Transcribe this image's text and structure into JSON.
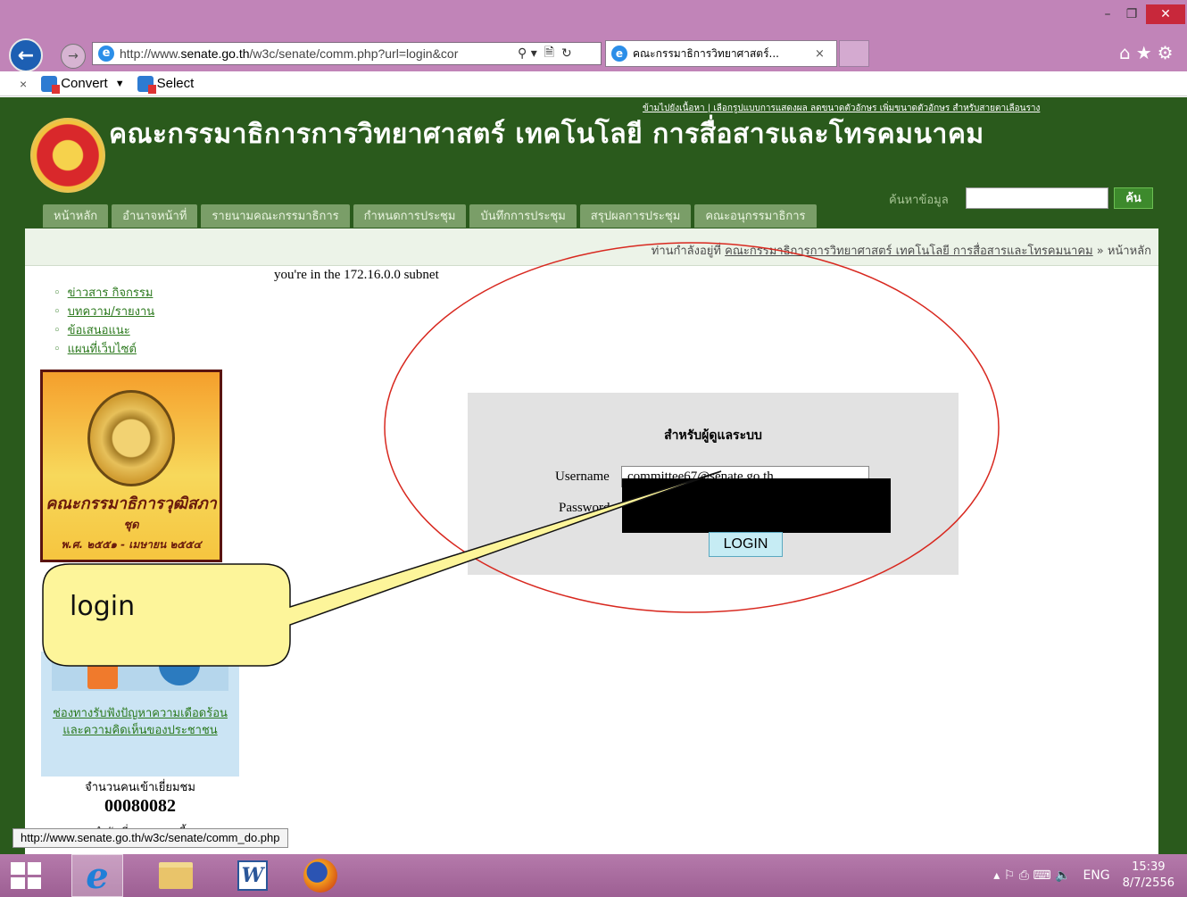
{
  "browser": {
    "url_host_prefix": "http://www.",
    "url_host": "senate.go.th",
    "url_path": "/w3c/senate/comm.php?url=login&cor",
    "tab_title": "คณะกรรมาธิการวิทยาศาสตร์...",
    "tab_close": "×",
    "window_min": "–",
    "window_max": "❐",
    "window_close": "✕",
    "back_icon": "←",
    "forward_icon": "→",
    "addr_search": "⚲ ▾",
    "addr_compat": "🗎",
    "addr_refresh": "↻",
    "tool_icons": "⌂★⚙"
  },
  "command_bar": {
    "close": "×",
    "convert_label": "Convert",
    "dropdown": "▼",
    "select_label": "Select"
  },
  "site": {
    "skip_links": "ข้ามไปยังเนื้อหา | เลือกรูปแบบการแสดงผล ลดขนาดตัวอักษร เพิ่มขนาดตัวอักษร สำหรับสายตาเลือนราง",
    "title": "คณะกรรมาธิการการวิทยาศาสตร์ เทคโนโลยี การสื่อสารและโทรคมนาคม",
    "nav": [
      "หน้าหลัก",
      "อำนาจหน้าที่",
      "รายนามคณะกรรมาธิการ",
      "กำหนดการประชุม",
      "บันทึกการประชุม",
      "สรุปผลการประชุม",
      "คณะอนุกรรมาธิการ"
    ],
    "search_label": "ค้นหาข้อมูล",
    "search_button": "ค้น"
  },
  "breadcrumb": {
    "prefix": "ท่านกำลังอยู่ที่ ",
    "link": "คณะกรรมาธิการการวิทยาศาสตร์ เทคโนโลยี การสื่อสารและโทรคมนาคม",
    "suffix": " » หน้าหลัก"
  },
  "subnet_text": "you're in the 172.16.0.0 subnet",
  "sidebar": {
    "links": [
      "ข่าวสาร กิจกรรม",
      "บทความ/รายงาน",
      "ข้อเสนอแนะ",
      "แผนที่เว็บไซต์"
    ],
    "banner_title": "คณะกรรมาธิการวุฒิสภา",
    "banner_sub": "ชุด",
    "banner_date": "พ.ศ. ๒๕๕๑ - เมษายน ๒๕๕๔",
    "complaint_link": "ช่องทางรับฟังปัญหาความเดือดร้อน และความคิดเห็นของประชาชน",
    "visitor_label": "จำนวนคนเข้าเยี่ยมชม",
    "visitor_count": "00080082",
    "online_label": "กำลังเยี่ยมชมขณะนี้"
  },
  "login": {
    "heading": "สำหรับผู้ดูแลระบบ",
    "username_label": "Username",
    "username_value": "committee67@senate.go.th",
    "password_label": "Password",
    "button": "LOGIN"
  },
  "annotation": {
    "callout_text": "login"
  },
  "status_bar": {
    "url": "http://www.senate.go.th/w3c/senate/comm_do.php"
  },
  "taskbar": {
    "ie_glyph": "e",
    "word_glyph": "W",
    "tray_icons": "▴  ⚐  ⎙  ⌨  🔈",
    "language": "ENG",
    "time": "15:39",
    "date": "8/7/2556"
  }
}
